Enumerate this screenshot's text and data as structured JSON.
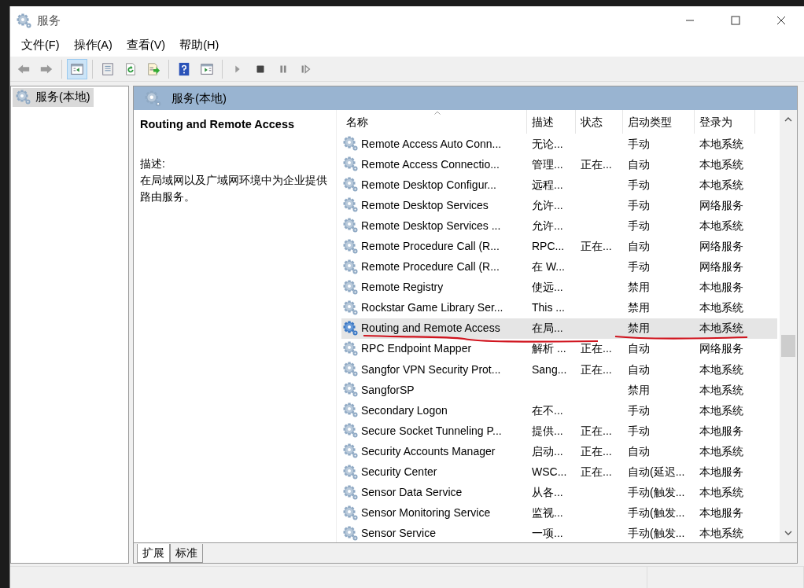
{
  "window": {
    "title": "服务"
  },
  "menu": [
    "文件(F)",
    "操作(A)",
    "查看(V)",
    "帮助(H)"
  ],
  "toolbar": [
    {
      "kind": "back",
      "pressed": false
    },
    {
      "kind": "forward",
      "pressed": false
    },
    {
      "kind": "sep"
    },
    {
      "kind": "tree",
      "pressed": true
    },
    {
      "kind": "sep"
    },
    {
      "kind": "properties",
      "pressed": false
    },
    {
      "kind": "refresh",
      "pressed": false
    },
    {
      "kind": "export",
      "pressed": false
    },
    {
      "kind": "sep"
    },
    {
      "kind": "help",
      "pressed": false
    },
    {
      "kind": "console",
      "pressed": false
    },
    {
      "kind": "sep"
    },
    {
      "kind": "play",
      "pressed": false
    },
    {
      "kind": "stop",
      "pressed": false
    },
    {
      "kind": "pause",
      "pressed": false
    },
    {
      "kind": "resume",
      "pressed": false
    }
  ],
  "tree": [
    {
      "label": "服务(本地)",
      "selected": true
    }
  ],
  "pane": {
    "title": "服务(本地)"
  },
  "details": {
    "service_name": "Routing and Remote Access",
    "description_label": "描述:",
    "description": "在局域网以及广域网环境中为企业提供路由服务。"
  },
  "table": {
    "columns": [
      {
        "label": "名称",
        "sorted": true
      },
      {
        "label": "描述",
        "sorted": false
      },
      {
        "label": "状态",
        "sorted": false
      },
      {
        "label": "启动类型",
        "sorted": false
      },
      {
        "label": "登录为",
        "sorted": false
      }
    ],
    "rows": [
      {
        "cells": [
          "Remote Access Auto Conn...",
          "无论...",
          "",
          "手动",
          "本地系统"
        ],
        "selected": false,
        "underlined": false
      },
      {
        "cells": [
          "Remote Access Connectio...",
          "管理...",
          "正在...",
          "自动",
          "本地系统"
        ],
        "selected": false,
        "underlined": false
      },
      {
        "cells": [
          "Remote Desktop Configur...",
          "远程...",
          "",
          "手动",
          "本地系统"
        ],
        "selected": false,
        "underlined": false
      },
      {
        "cells": [
          "Remote Desktop Services",
          "允许...",
          "",
          "手动",
          "网络服务"
        ],
        "selected": false,
        "underlined": false
      },
      {
        "cells": [
          "Remote Desktop Services ...",
          "允许...",
          "",
          "手动",
          "本地系统"
        ],
        "selected": false,
        "underlined": false
      },
      {
        "cells": [
          "Remote Procedure Call (R...",
          "RPC...",
          "正在...",
          "自动",
          "网络服务"
        ],
        "selected": false,
        "underlined": false
      },
      {
        "cells": [
          "Remote Procedure Call (R...",
          "在 W...",
          "",
          "手动",
          "网络服务"
        ],
        "selected": false,
        "underlined": false
      },
      {
        "cells": [
          "Remote Registry",
          "使远...",
          "",
          "禁用",
          "本地服务"
        ],
        "selected": false,
        "underlined": false
      },
      {
        "cells": [
          "Rockstar Game Library Ser...",
          "This ...",
          "",
          "禁用",
          "本地系统"
        ],
        "selected": false,
        "underlined": false
      },
      {
        "cells": [
          "Routing and Remote Access",
          "在局...",
          "",
          "禁用",
          "本地系统"
        ],
        "selected": true,
        "underlined": true
      },
      {
        "cells": [
          "RPC Endpoint Mapper",
          "解析 ...",
          "正在...",
          "自动",
          "网络服务"
        ],
        "selected": false,
        "underlined": false
      },
      {
        "cells": [
          "Sangfor VPN Security Prot...",
          "Sang...",
          "正在...",
          "自动",
          "本地系统"
        ],
        "selected": false,
        "underlined": false
      },
      {
        "cells": [
          "SangforSP",
          "",
          "",
          "禁用",
          "本地系统"
        ],
        "selected": false,
        "underlined": false
      },
      {
        "cells": [
          "Secondary Logon",
          "在不...",
          "",
          "手动",
          "本地系统"
        ],
        "selected": false,
        "underlined": false
      },
      {
        "cells": [
          "Secure Socket Tunneling P...",
          "提供...",
          "正在...",
          "手动",
          "本地服务"
        ],
        "selected": false,
        "underlined": false
      },
      {
        "cells": [
          "Security Accounts Manager",
          "启动...",
          "正在...",
          "自动",
          "本地系统"
        ],
        "selected": false,
        "underlined": false
      },
      {
        "cells": [
          "Security Center",
          "WSC...",
          "正在...",
          "自动(延迟...",
          "本地服务"
        ],
        "selected": false,
        "underlined": false
      },
      {
        "cells": [
          "Sensor Data Service",
          "从各...",
          "",
          "手动(触发...",
          "本地系统"
        ],
        "selected": false,
        "underlined": false
      },
      {
        "cells": [
          "Sensor Monitoring Service",
          "监视...",
          "",
          "手动(触发...",
          "本地服务"
        ],
        "selected": false,
        "underlined": false
      },
      {
        "cells": [
          "Sensor Service",
          "一项...",
          "",
          "手动(触发...",
          "本地系统"
        ],
        "selected": false,
        "underlined": false
      }
    ]
  },
  "view_tabs": [
    {
      "label": "扩展",
      "selected": true
    },
    {
      "label": "标准",
      "selected": false
    }
  ]
}
